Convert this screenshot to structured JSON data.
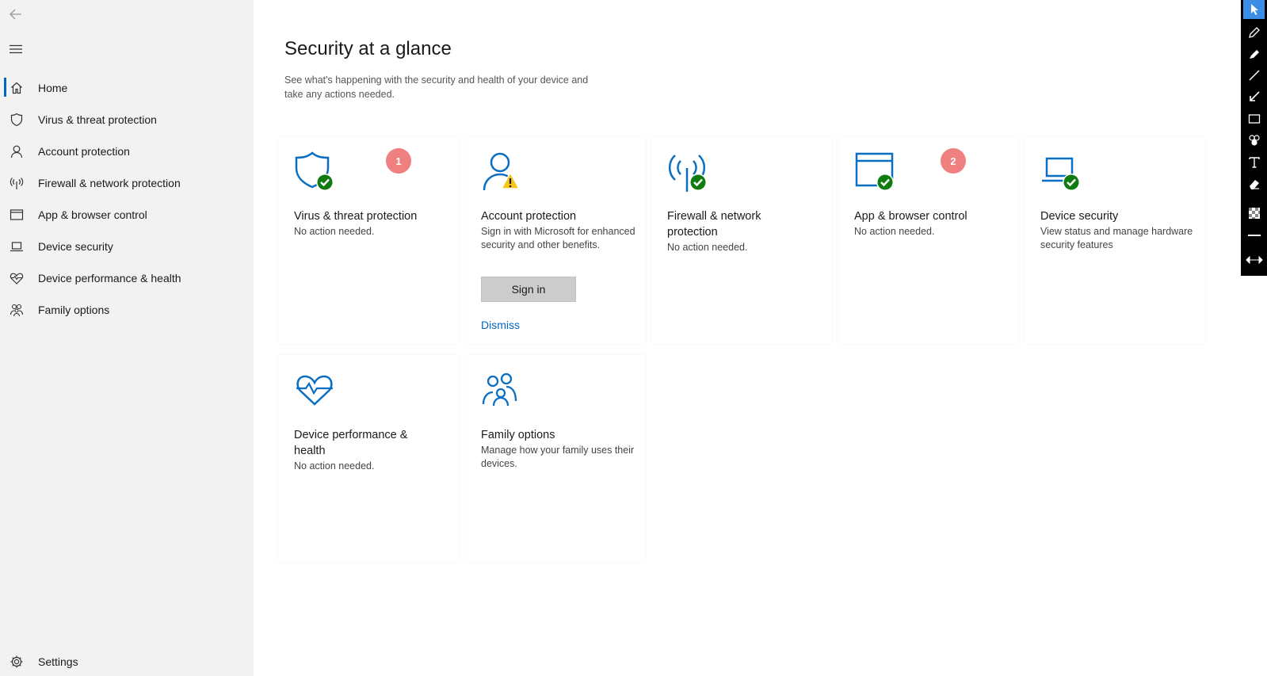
{
  "sidebar": {
    "items": [
      {
        "label": "Home",
        "icon": "home-icon",
        "active": true
      },
      {
        "label": "Virus & threat protection",
        "icon": "shield-icon"
      },
      {
        "label": "Account protection",
        "icon": "person-icon"
      },
      {
        "label": "Firewall & network protection",
        "icon": "antenna-icon"
      },
      {
        "label": "App & browser control",
        "icon": "browser-window-icon"
      },
      {
        "label": "Device security",
        "icon": "laptop-icon"
      },
      {
        "label": "Device performance & health",
        "icon": "heart-pulse-icon"
      },
      {
        "label": "Family options",
        "icon": "family-icon"
      }
    ],
    "settings_label": "Settings"
  },
  "main": {
    "title": "Security at a glance",
    "description": "See what's happening with the security and health of your device and take any actions needed."
  },
  "cards": [
    {
      "title": "Virus & threat protection",
      "desc": "No action needed.",
      "badge": "1",
      "icon": "shield-check-icon"
    },
    {
      "title": "Account protection",
      "desc": "Sign in with Microsoft for enhanced security and other benefits.",
      "button": "Sign in",
      "link": "Dismiss",
      "icon": "person-warning-icon"
    },
    {
      "title": "Firewall & network protection",
      "desc": "No action needed.",
      "icon": "antenna-check-icon"
    },
    {
      "title": "App & browser control",
      "desc": "No action needed.",
      "badge": "2",
      "icon": "browser-check-icon"
    },
    {
      "title": "Device security",
      "desc": "View status and manage hardware security features",
      "icon": "laptop-check-icon"
    },
    {
      "title": "Device performance & health",
      "desc": "No action needed.",
      "icon": "heart-pulse-icon"
    },
    {
      "title": "Family options",
      "desc": "Manage how your family uses their devices.",
      "icon": "family-icon"
    }
  ],
  "colors": {
    "accent": "#0067c0",
    "icon_blue": "#0a6fc2",
    "check_green": "#107c10",
    "warning_yellow": "#f5c518",
    "badge": "#f08080",
    "sidebar_bg": "#f2f2f2"
  },
  "toolbar": {
    "tools": [
      "pointer-icon",
      "pen-icon",
      "highlighter-icon",
      "line-icon",
      "arrow-icon",
      "rectangle-icon",
      "effects-icon",
      "text-icon",
      "eraser-icon",
      "opacity-icon",
      "line-width-icon",
      "expand-arrows-icon"
    ]
  }
}
